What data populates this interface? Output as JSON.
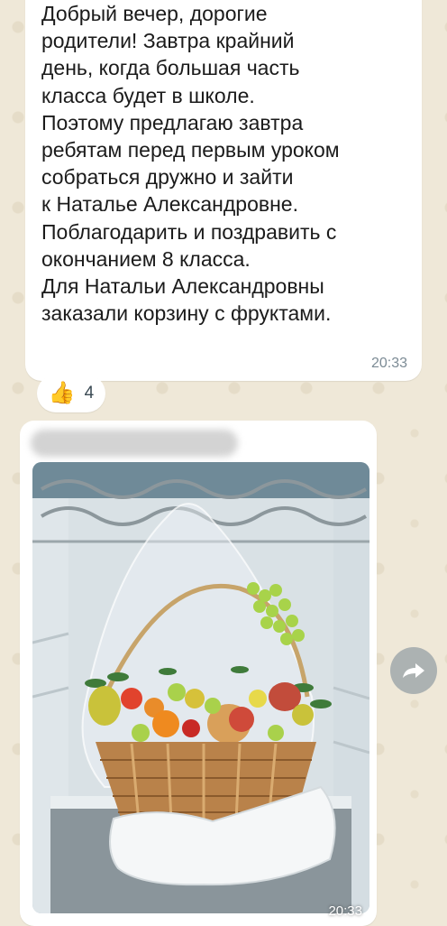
{
  "message": {
    "text": "Добрый вечер, дорогие\nродители! Завтра крайний\nдень, когда большая часть\nкласса будет в школе.\nПоэтому предлагаю завтра\nребятам перед первым уроком\nсобраться дружно и зайти\nк Наталье Александровне.\nПоблагодарить и поздравить с\nокончанием 8 класса.\nДля Натальи Александровны\nзаказали корзину с фруктами.",
    "time": "20:33"
  },
  "reaction": {
    "emoji": "👍",
    "count": "4"
  },
  "photo_message": {
    "image_description": "fruit-basket-in-fridge",
    "time": "20:33"
  },
  "icons": {
    "forward": "forward-icon"
  },
  "colors": {
    "background": "#efe8d8",
    "bubble": "#ffffff",
    "time_text": "#7c8b95",
    "forward_button": "#969fa5"
  }
}
